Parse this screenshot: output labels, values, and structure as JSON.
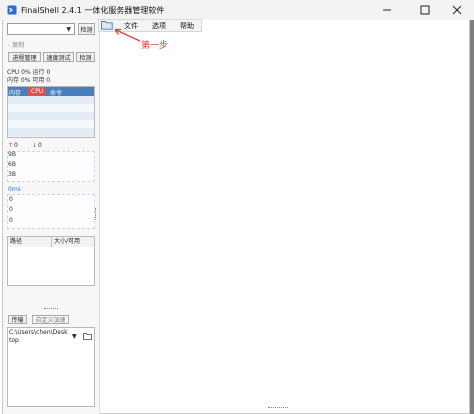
{
  "window": {
    "title": "FinalShell 2.4.1 一体化服务器管理软件",
    "controls": [
      "minimize-icon",
      "maximize-icon",
      "close-icon"
    ]
  },
  "toolbar": {
    "check_button": "检测",
    "menus": [
      "文件",
      "选项",
      "帮助"
    ]
  },
  "annotation": {
    "text": "第一步",
    "color": "#e53935"
  },
  "status": {
    "copy_label": "- 复制",
    "cpu_line": "CPU 0%  运行 0",
    "mem_line": "内存 0%  可用 0",
    "buttons": [
      "进程管理",
      "速度测试",
      "检测"
    ]
  },
  "process_table": {
    "headers": [
      "内存",
      "CPU",
      "命令"
    ]
  },
  "network": {
    "up": "0",
    "down": "0",
    "scale": [
      "9B",
      "6B",
      "3B"
    ]
  },
  "ping": {
    "label": "0ms",
    "values": [
      "0",
      "0",
      "0"
    ]
  },
  "disk_table": {
    "headers": [
      "路径",
      "大小/可用"
    ]
  },
  "transfer": {
    "tabs": [
      "传输",
      "自定义加速"
    ],
    "path": "C:\\Users\\chen\\Desktop"
  },
  "colors": {
    "table_header": "#4a7fbd",
    "cpu_header": "#d9534f",
    "up_arrow": "#d9342b",
    "down_arrow": "#2e9d44"
  }
}
